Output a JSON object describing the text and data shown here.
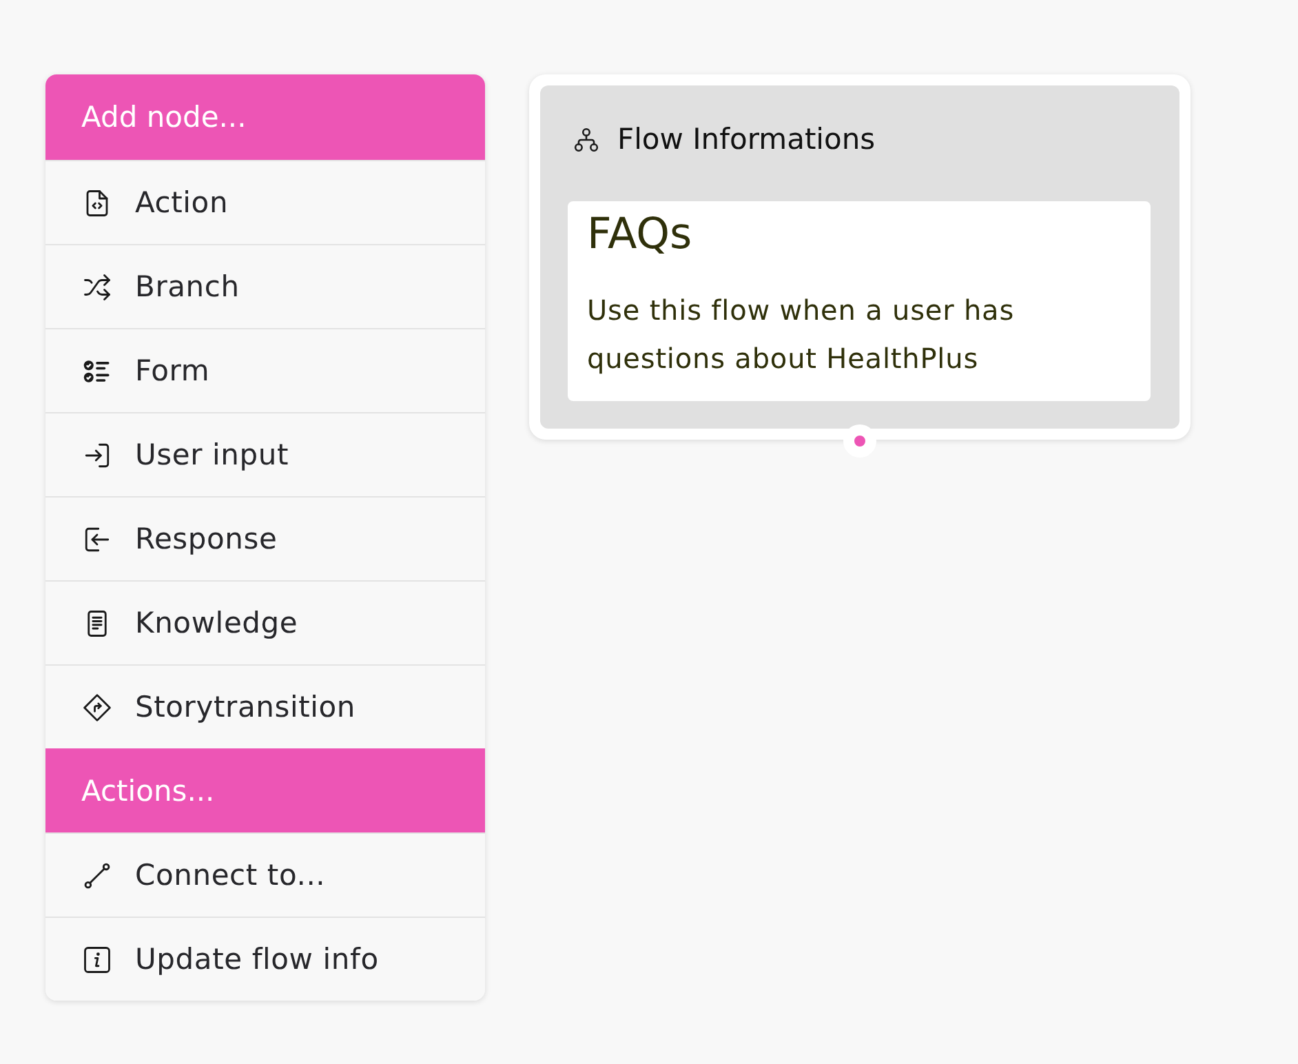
{
  "menu": {
    "sections": [
      {
        "title": "Add node...",
        "items": [
          {
            "kind": "action",
            "label": "Action"
          },
          {
            "kind": "branch",
            "label": "Branch"
          },
          {
            "kind": "form",
            "label": "Form"
          },
          {
            "kind": "input",
            "label": "User input"
          },
          {
            "kind": "response",
            "label": "Response"
          },
          {
            "kind": "knowledge",
            "label": "Knowledge"
          },
          {
            "kind": "transition",
            "label": "Storytransition"
          }
        ]
      },
      {
        "title": "Actions...",
        "items": [
          {
            "kind": "connect",
            "label": "Connect to..."
          },
          {
            "kind": "info",
            "label": "Update flow info"
          }
        ]
      }
    ]
  },
  "node": {
    "title": "Flow Informations",
    "card": {
      "heading": "FAQs",
      "description": "Use this flow when a user has questions about HealthPlus"
    }
  }
}
